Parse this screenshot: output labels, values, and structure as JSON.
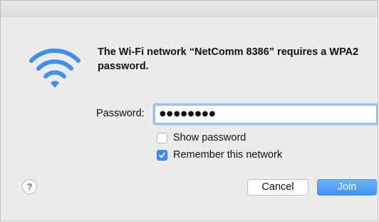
{
  "dialog": {
    "message": "The Wi-Fi network “NetComm 8386” requires a WPA2 password.",
    "icon": "wifi-icon"
  },
  "password": {
    "label": "Password:",
    "masked_value": "●●●●●●●●"
  },
  "options": {
    "show_password": {
      "label": "Show password",
      "checked": false
    },
    "remember_network": {
      "label": "Remember this network",
      "checked": true
    }
  },
  "buttons": {
    "help": "?",
    "cancel": "Cancel",
    "join": "Join"
  },
  "colors": {
    "accent": "#3b8ef0",
    "dialog_bg": "#ececec"
  }
}
